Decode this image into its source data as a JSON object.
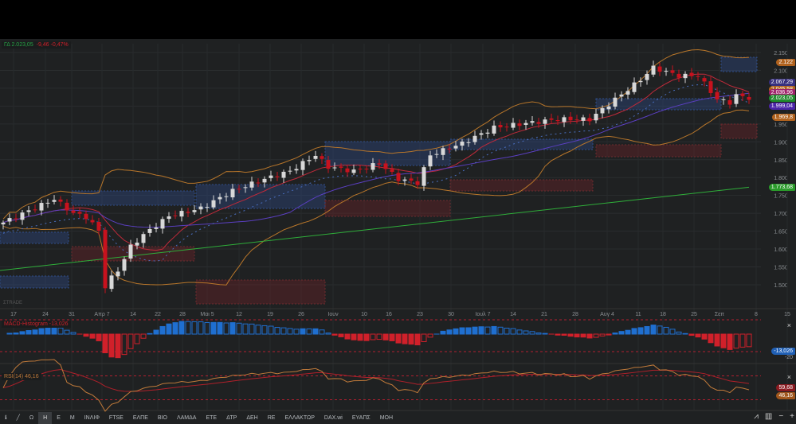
{
  "header": {
    "symbol": "ΓΔ",
    "last": "2.023,05",
    "change": "-9,46",
    "change_pct": "-0,47%"
  },
  "watermark": "ΣTRADE",
  "price_axis": {
    "labels": [
      "2.150",
      "2.100",
      "2.050",
      "2.000",
      "1.950",
      "1.900",
      "1.850",
      "1.800",
      "1.750",
      "1.700",
      "1.650",
      "1.600",
      "1.550",
      "1.500"
    ]
  },
  "price_tags": [
    {
      "text": "2.122",
      "color": "#b0621e",
      "value": 2122
    },
    {
      "text": "2.067,29",
      "color": "#38307e",
      "value": 2067
    },
    {
      "text": "2.045,58",
      "color": "#b0621e",
      "value": 2046
    },
    {
      "text": "2.036,96",
      "color": "#a0206a",
      "value": 2037
    },
    {
      "text": "2.023,05",
      "color": "#1f8a2c",
      "value": 2023
    },
    {
      "text": "1.999,04",
      "color": "#4b25a8",
      "value": 1999
    },
    {
      "text": "1.969,8",
      "color": "#b0621e",
      "value": 1969
    },
    {
      "text": "1.773,68",
      "color": "#2a9a2a",
      "value": 1773
    }
  ],
  "x_axis": {
    "labels": [
      "17",
      "24",
      "31",
      "Απρ 7",
      "14",
      "22",
      "28",
      "Μαι 5",
      "12",
      "19",
      "26",
      "Ιουν",
      "10",
      "16",
      "23",
      "30",
      "Ιουλ 7",
      "14",
      "21",
      "28",
      "Αυγ 4",
      "11",
      "18",
      "25",
      "Σεπ",
      "8",
      "15"
    ]
  },
  "chart_data": {
    "type": "candlestick",
    "price_path": [
      [
        0,
        1674
      ],
      [
        4,
        1707
      ],
      [
        8,
        1740
      ],
      [
        11,
        1700
      ],
      [
        13,
        1690
      ],
      [
        15,
        1651
      ],
      [
        16,
        1495
      ],
      [
        17,
        1520
      ],
      [
        18,
        1540
      ],
      [
        20,
        1607
      ],
      [
        22,
        1640
      ],
      [
        26,
        1692
      ],
      [
        31,
        1714
      ],
      [
        36,
        1763
      ],
      [
        41,
        1796
      ],
      [
        45,
        1818
      ],
      [
        49,
        1863
      ],
      [
        51,
        1830
      ],
      [
        55,
        1818
      ],
      [
        59,
        1840
      ],
      [
        62,
        1796
      ],
      [
        65,
        1785
      ],
      [
        67,
        1863
      ],
      [
        72,
        1896
      ],
      [
        77,
        1940
      ],
      [
        82,
        1952
      ],
      [
        87,
        1963
      ],
      [
        92,
        1963
      ],
      [
        96,
        2019
      ],
      [
        100,
        2074
      ],
      [
        102,
        2108
      ],
      [
        104,
        2096
      ],
      [
        106,
        2085
      ],
      [
        109,
        2085
      ],
      [
        110,
        2063
      ],
      [
        112,
        2019
      ],
      [
        114,
        2010
      ],
      [
        115,
        2030
      ],
      [
        117,
        2023
      ]
    ],
    "ma200": [
      1540,
      1773
    ]
  },
  "macd": {
    "label": "MACD-Histogram",
    "value": "-13,026",
    "axis": "-20",
    "close": "×"
  },
  "rsi": {
    "label": "RSI(14)",
    "value": "46,16",
    "ma_value": "59,68",
    "close": "×"
  },
  "toolbar": {
    "items": [
      "Ω",
      "H",
      "E",
      "M",
      "ΙΝΛΙΦ",
      "FTSE",
      "ΕΛΠΕ",
      "ΒΙΟ",
      "ΛΑΜΔΑ",
      "ΕΤΕ",
      "ΔΤΡ",
      "ΔΕΗ",
      "RE",
      "ΕΛΛΑΚΤΩΡ",
      "DAX.wi",
      "ΕΥΑΠΣ",
      "ΜΟΗ"
    ],
    "selected": "H",
    "zoom_out": "−",
    "zoom_in": "+"
  }
}
